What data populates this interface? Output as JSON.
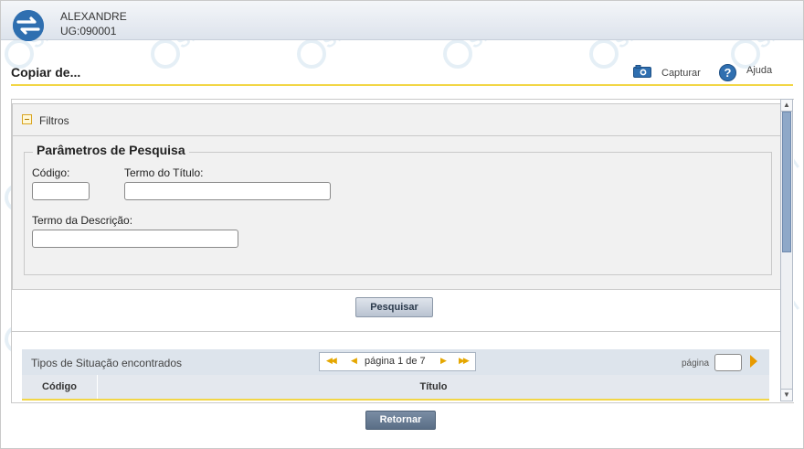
{
  "header": {
    "user_name": "ALEXANDRE",
    "user_ug": "UG:090001"
  },
  "page": {
    "title": "Copiar de...",
    "capture_label": "Capturar",
    "help_label": "Ajuda"
  },
  "filters": {
    "panel_label": "Filtros",
    "legend": "Parâmetros de Pesquisa",
    "codigo_label": "Código:",
    "codigo_value": "",
    "termo_titulo_label": "Termo do Título:",
    "termo_titulo_value": "",
    "termo_descricao_label": "Termo da Descrição:",
    "termo_descricao_value": "",
    "search_button": "Pesquisar"
  },
  "results": {
    "title": "Tipos de Situação encontrados",
    "pager_text": "página 1 de 7",
    "goto_label": "página",
    "goto_value": "",
    "columns": [
      "Código",
      "Título"
    ]
  },
  "footer": {
    "back_button": "Retornar"
  },
  "colors": {
    "accent_yellow": "#f2d646",
    "header_blue": "#2f6fb0",
    "button_dark": "#5a6e86"
  },
  "icons": {
    "logo": "siafi-logo",
    "capture": "camera-icon",
    "help": "help-icon",
    "collapse": "collapse-icon",
    "goto": "arrow-right-icon"
  },
  "watermark": {
    "text": "SIAFI"
  }
}
